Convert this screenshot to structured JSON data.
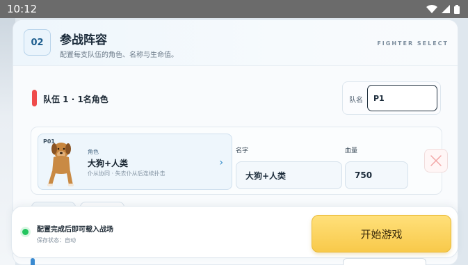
{
  "statusbar": {
    "time": "10:12"
  },
  "header": {
    "step": "02",
    "title": "参战阵容",
    "subtitle": "配置每支队伍的角色、名称与生命值。",
    "eyebrow": "FIGHTER SELECT"
  },
  "team": {
    "label": "队伍 1 · 1名角色",
    "name_label": "队名",
    "name_value": "P1",
    "color": "#ef4b4b"
  },
  "fighter": {
    "player_tag": "P01",
    "role_label": "角色",
    "character_name": "大狗+人类",
    "description": "仆从协同 · 失去仆从后连续扑击",
    "name_label": "名字",
    "name_value": "大狗+人类",
    "hp_label": "血量",
    "hp_value": "750"
  },
  "footer": {
    "status_title": "配置完成后即可载入战场",
    "save_status": "保存状态：自动",
    "start_label": "开始游戏",
    "accent": "#f8c94a"
  }
}
